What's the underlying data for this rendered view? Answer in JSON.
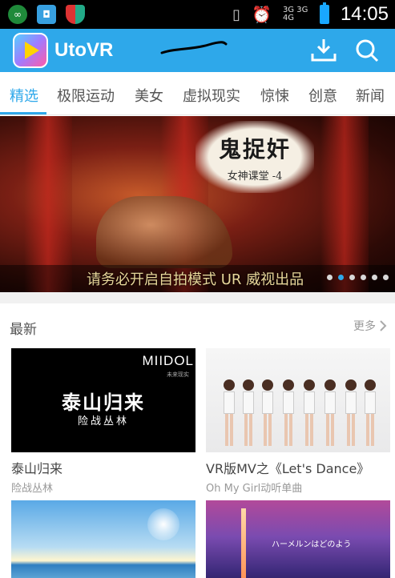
{
  "status_bar": {
    "network_label": "3G 3G 4G",
    "time": "14:05",
    "icons": [
      "infinity-icon",
      "screenshot-icon",
      "shield-icon",
      "vibrate-icon",
      "alarm-icon",
      "signal-icon",
      "battery-icon"
    ]
  },
  "app_bar": {
    "title": "UtoVR",
    "download_icon": "download-icon",
    "search_icon": "search-icon",
    "accent_color": "#2ea8ea"
  },
  "tabs": [
    {
      "label": "精选",
      "active": true
    },
    {
      "label": "极限运动",
      "active": false
    },
    {
      "label": "美女",
      "active": false
    },
    {
      "label": "虚拟现实",
      "active": false
    },
    {
      "label": "惊悚",
      "active": false
    },
    {
      "label": "创意",
      "active": false
    },
    {
      "label": "新闻",
      "active": false
    }
  ],
  "banner": {
    "title": "鬼捉奸",
    "subtitle": "女神课堂 -4",
    "caption": "请务必开启自拍模式 UR 威视出品",
    "dots_total": 6,
    "dots_active_index": 1
  },
  "section": {
    "title": "最新",
    "more_label": "更多"
  },
  "cards": [
    {
      "title": "泰山归来",
      "subtitle": "险战丛林",
      "thumb_brand": "MIIDOL",
      "thumb_brand_sub": "未来现实",
      "thumb_big": "泰山归来",
      "thumb_small": "险战丛林"
    },
    {
      "title": "VR版MV之《Let's Dance》",
      "subtitle": "Oh My Girl动听单曲"
    },
    {
      "title": "",
      "subtitle": ""
    },
    {
      "title": "",
      "subtitle": "",
      "thumb_text": "ハーメルンはどのよう"
    }
  ]
}
